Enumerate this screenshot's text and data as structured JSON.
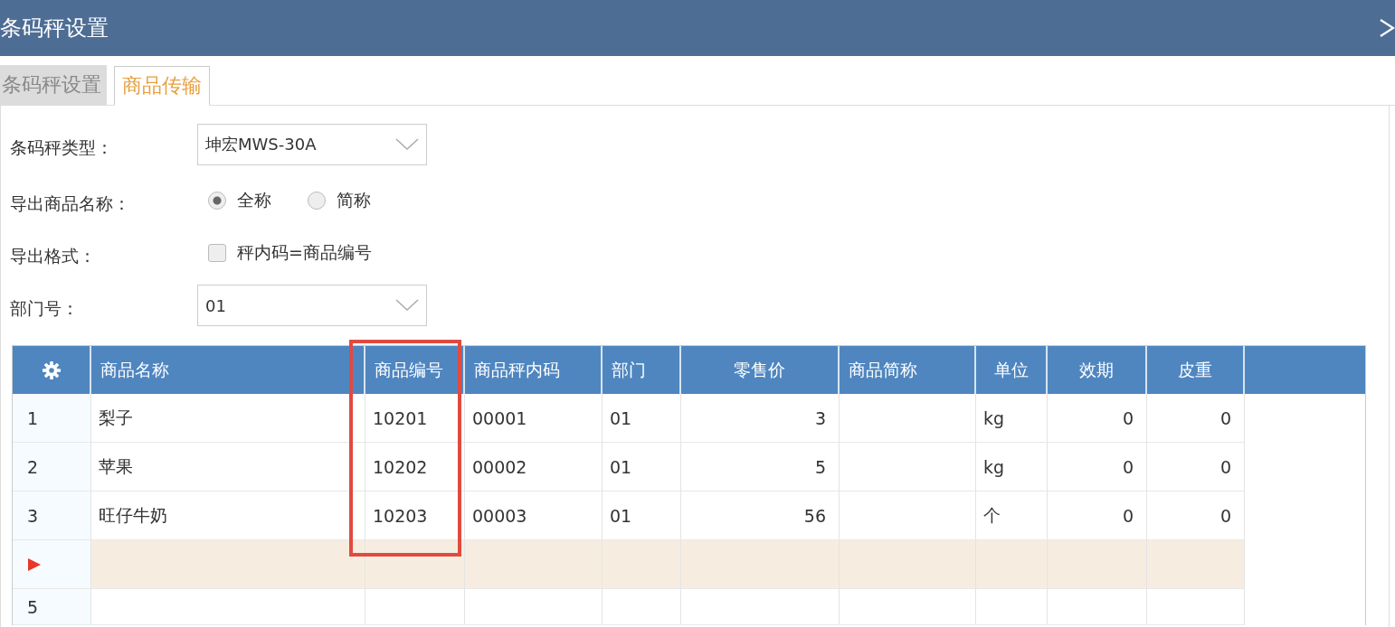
{
  "window": {
    "title": "条码秤设置"
  },
  "tabs": [
    {
      "label": "条码秤设置",
      "selected": false
    },
    {
      "label": "商品传输",
      "selected": true
    }
  ],
  "form": {
    "scale_type": {
      "label": "条码秤类型：",
      "value": "坤宏MWS-30A"
    },
    "export_name": {
      "label": "导出商品名称：",
      "options": [
        {
          "label": "全称",
          "selected": true
        },
        {
          "label": "简称",
          "selected": false
        }
      ]
    },
    "export_format": {
      "label": "导出格式：",
      "option": {
        "label": "秤内码=商品编号",
        "checked": false
      }
    },
    "department": {
      "label": "部门号：",
      "value": "01"
    }
  },
  "table": {
    "columns": [
      "商品名称",
      "商品编号",
      "商品秤内码",
      "部门",
      "零售价",
      "商品简称",
      "单位",
      "效期",
      "皮重"
    ],
    "rows": [
      {
        "row_number": "1",
        "current": false,
        "cells": [
          "梨子",
          "10201",
          "00001",
          "01",
          "3",
          null,
          "kg",
          "0",
          "0"
        ]
      },
      {
        "row_number": "2",
        "current": false,
        "cells": [
          "苹果",
          "10202",
          "00002",
          "01",
          "5",
          null,
          "kg",
          "0",
          "0"
        ]
      },
      {
        "row_number": "3",
        "current": false,
        "cells": [
          "旺仔牛奶",
          "10203",
          "00003",
          "01",
          "56",
          null,
          "个",
          "0",
          "0"
        ]
      },
      {
        "current": true
      },
      {
        "row_number": "5",
        "current": false
      }
    ]
  }
}
